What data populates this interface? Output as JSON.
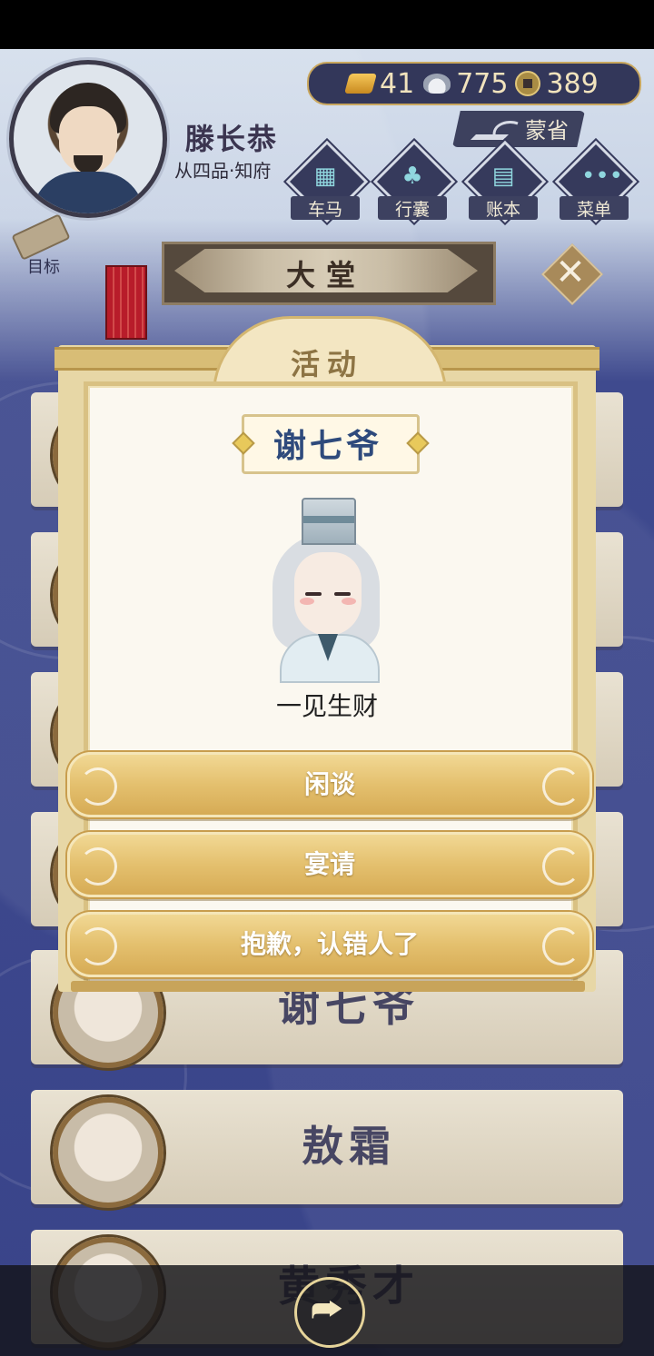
{
  "player": {
    "name": "滕长恭",
    "rank": "从四品·知府"
  },
  "currency": {
    "gold": "41",
    "silver": "775",
    "copper": "389"
  },
  "province_button": {
    "label": "蒙省"
  },
  "nav": [
    {
      "label": "车马",
      "icon": "carriage-icon"
    },
    {
      "label": "行囊",
      "icon": "bag-icon"
    },
    {
      "label": "账本",
      "icon": "ledger-icon"
    },
    {
      "label": "菜单",
      "icon": "menu-dots-icon"
    }
  ],
  "goal": {
    "label": "目标"
  },
  "hall": {
    "title": "大堂",
    "close_glyph": "✕"
  },
  "list": [
    {
      "name": ""
    },
    {
      "name": ""
    },
    {
      "name": ""
    },
    {
      "name": ""
    },
    {
      "name": "谢七爷"
    },
    {
      "name": "敖霜"
    },
    {
      "name": "黄秀才"
    }
  ],
  "dialog": {
    "title": "活动",
    "npc_name": "谢七爷",
    "npc_description": "一见生财",
    "options": [
      {
        "label": "闲谈"
      },
      {
        "label": "宴请"
      },
      {
        "label": "抱歉，认错人了"
      }
    ]
  },
  "share": {
    "glyph": "⮫",
    "icon": "share-icon"
  }
}
